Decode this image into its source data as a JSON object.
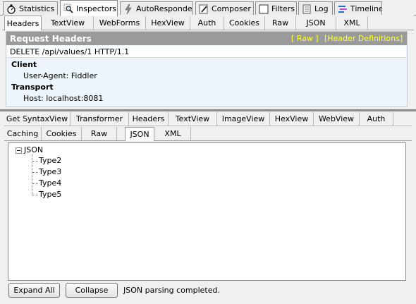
{
  "main_tabs": [
    {
      "label": "Statistics",
      "icon": "stopwatch-icon"
    },
    {
      "label": "Inspectors",
      "icon": "magnifier-icon",
      "active": true
    },
    {
      "label": "AutoResponder",
      "icon": "lightning-icon"
    },
    {
      "label": "Composer",
      "icon": "pencil-icon"
    },
    {
      "label": "Filters",
      "icon": "checkbox-icon"
    },
    {
      "label": "Log",
      "icon": "log-icon"
    },
    {
      "label": "Timeline",
      "icon": "timeline-icon"
    }
  ],
  "request_tabs": [
    "Headers",
    "TextView",
    "WebForms",
    "HexView",
    "Auth",
    "Cookies",
    "Raw",
    "JSON",
    "XML"
  ],
  "request_headers": {
    "title": "Request Headers",
    "raw_link": "[ Raw ]",
    "definitions_link": "[Header Definitions]",
    "request_line": "DELETE /api/values/1 HTTP/1.1",
    "groups": [
      {
        "name": "Client",
        "headers": [
          "User-Agent: Fiddler"
        ]
      },
      {
        "name": "Transport",
        "headers": [
          "Host: localhost:8081"
        ]
      }
    ]
  },
  "response_tabs_row1": [
    "Get SyntaxView",
    "Transformer",
    "Headers",
    "TextView",
    "ImageView",
    "HexView",
    "WebView",
    "Auth"
  ],
  "response_tabs_row2": [
    "Caching",
    "Cookies",
    "Raw",
    "JSON",
    "XML"
  ],
  "json_tree": {
    "root": "JSON",
    "children": [
      "Type2",
      "Type3",
      "Type4",
      "Type5"
    ]
  },
  "bottom": {
    "expand_all": "Expand All",
    "collapse": "Collapse",
    "status": "JSON parsing completed."
  },
  "colors": {
    "panel_background": "#edf4fb",
    "title_bar": "#9a9a9a",
    "link_yellow": "#ffff3c"
  }
}
